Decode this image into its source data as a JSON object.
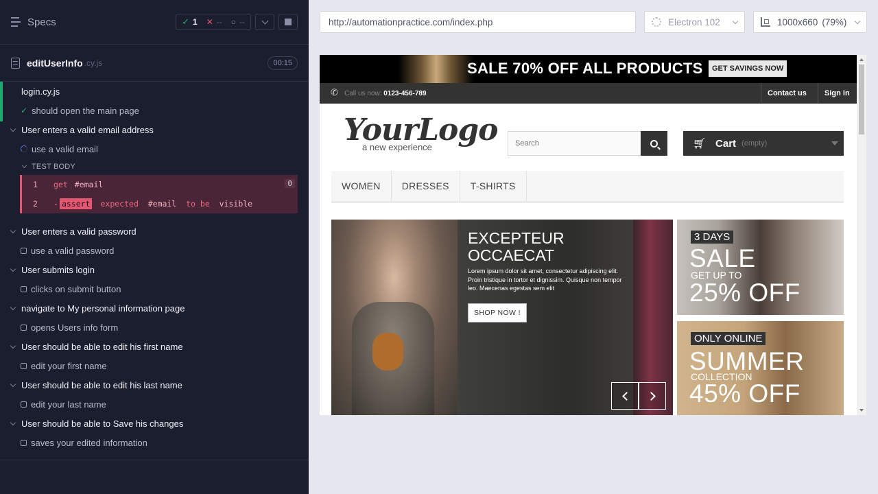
{
  "reporter": {
    "specs_title": "Specs",
    "stats": {
      "passed": "1",
      "failed": "--",
      "pending": "--"
    },
    "file": {
      "name": "editUserInfo",
      "ext": ".cy.js",
      "duration": "00:15"
    },
    "suites": [
      {
        "title": "login.cy.js",
        "tests": [
          {
            "title": "should open the main page"
          }
        ]
      },
      {
        "title": "User enters a valid email address",
        "tests": [
          {
            "title": "use a valid email"
          }
        ]
      },
      {
        "title": "User enters a valid password",
        "tests": [
          {
            "title": "use a valid password"
          }
        ]
      },
      {
        "title": "User submits login",
        "tests": [
          {
            "title": "clicks on submit button"
          }
        ]
      },
      {
        "title": "navigate to My personal information page",
        "tests": [
          {
            "title": "opens Users info form"
          }
        ]
      },
      {
        "title": "User should be able to edit his first name",
        "tests": [
          {
            "title": "edit your first name"
          }
        ]
      },
      {
        "title": "User should be able to edit his last name",
        "tests": [
          {
            "title": "edit your last name"
          }
        ]
      },
      {
        "title": "User should be able to Save his changes",
        "tests": [
          {
            "title": "saves your edited information"
          }
        ]
      }
    ],
    "test_body": {
      "label": "TEST BODY",
      "commands": [
        {
          "num": "1",
          "name": "get",
          "message": "#email",
          "count": "0"
        },
        {
          "num": "2",
          "dash": "-",
          "name": "assert",
          "parts": [
            "expected",
            "#email",
            "to be",
            "visible"
          ]
        }
      ]
    },
    "colors": {
      "pass": "#1fa971",
      "fail": "#e45770",
      "bg": "#1b1e2e"
    }
  },
  "aut": {
    "url": "http://automationpractice.com/index.php",
    "browser": "Electron 102",
    "viewport": "1000x660",
    "scale": "(79%)"
  },
  "site": {
    "promo": {
      "text": "SALE 70% OFF ALL PRODUCTS",
      "button": "GET SAVINGS NOW"
    },
    "topbar": {
      "call_label": "Call us now:",
      "phone": "0123-456-789",
      "contact": "Contact us",
      "signin": "Sign in"
    },
    "logo": {
      "main": "YourLogo",
      "sub": "a new experience"
    },
    "search": {
      "placeholder": "Search"
    },
    "cart": {
      "label": "Cart",
      "state": "(empty)"
    },
    "menu": [
      "WOMEN",
      "DRESSES",
      "T-SHIRTS"
    ],
    "slide": {
      "title1": "EXCEPTEUR",
      "title2": "OCCAECAT",
      "text": "Lorem ipsum dolor sit amet, consectetur adipiscing elit. Proin tristique in tortor et dignissim. Quisque non tempor leo. Maecenas egestas sem elit",
      "button": "SHOP NOW !"
    },
    "banner1": {
      "tag": "3 DAYS",
      "big": "SALE",
      "mid": "GET UP TO",
      "big2": "25% OFF"
    },
    "banner2": {
      "tag": "ONLY ONLINE",
      "big": "SUMMER",
      "mid": "COLLECTION",
      "big2": "45% OFF"
    }
  }
}
